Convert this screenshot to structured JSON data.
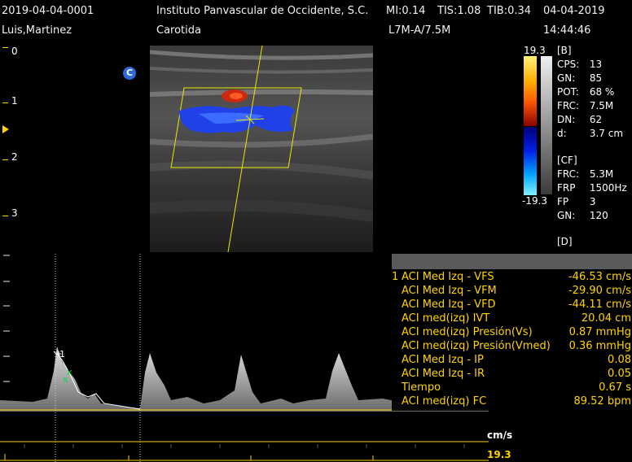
{
  "header": {
    "patient_id": "2019-04-04-0001",
    "patient_name": "Luis,Martinez",
    "institution": "Instituto Panvascular de Occidente, S.C.",
    "mi": "MI:0.14",
    "tis": "TIS:1.08",
    "tib": "TIB:0.34",
    "date": "04-04-2019",
    "study": "Carotida",
    "probe": "L7M-A/7.5M",
    "time": "14:44:46"
  },
  "depth_scale": [
    "0",
    "1",
    "2",
    "3"
  ],
  "color_bar": {
    "max": "19.3",
    "min": "-19.3"
  },
  "c_marker": "C",
  "params": {
    "b_title": "[B]",
    "b": [
      {
        "k": "CPS:",
        "v": "13"
      },
      {
        "k": "GN:",
        "v": "85"
      },
      {
        "k": "POT:",
        "v": "68 %"
      },
      {
        "k": "FRC:",
        "v": "7.5M"
      },
      {
        "k": "DN:",
        "v": "62"
      },
      {
        "k": "d:",
        "v": "3.7 cm"
      }
    ],
    "cf_title": "[CF]",
    "cf": [
      {
        "k": "FRC:",
        "v": "5.3M"
      },
      {
        "k": "FRP",
        "v": "1500Hz"
      },
      {
        "k": "FP",
        "v": "3"
      },
      {
        "k": "GN:",
        "v": "120"
      }
    ],
    "d_title": "[D]"
  },
  "measurements": {
    "first_index": "1",
    "rows": [
      {
        "label": "ACI Med Izq - VFS",
        "value": "-46.53 cm/s"
      },
      {
        "label": "ACI Med Izq - VFM",
        "value": "-29.90 cm/s"
      },
      {
        "label": "ACI Med Izq - VFD",
        "value": "-44.11 cm/s"
      },
      {
        "label": "ACI med(izq) IVT",
        "value": "20.04 cm"
      },
      {
        "label": "ACI med(izq) Presión(Vs)",
        "value": "0.87 mmHg"
      },
      {
        "label": "ACI med(izq) Presión(Vmed)",
        "value": "0.36 mmHg"
      },
      {
        "label": "ACI Med Izq - IP",
        "value": "0.08"
      },
      {
        "label": "ACI Med Izq - IR",
        "value": "0.05"
      },
      {
        "label": "Tiempo",
        "value": "0.67 s"
      },
      {
        "label": "ACI med(izq) FC",
        "value": "89.52 bpm"
      }
    ]
  },
  "spectrum": {
    "unit": "cm/s",
    "scale_max": "19.3",
    "cursor_label": "1"
  }
}
